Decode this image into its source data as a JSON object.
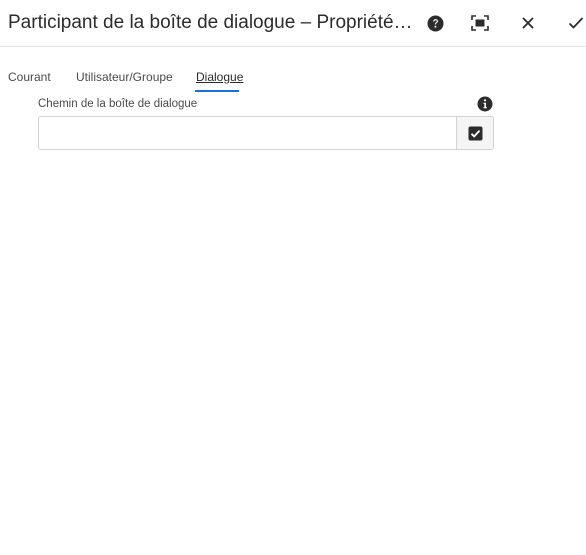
{
  "dialog": {
    "title": "Participant de la boîte de dialogue – Propriétés des éta..."
  },
  "header_actions": {
    "help_icon": "question-circle-icon",
    "fullscreen_icon": "fullscreen-icon",
    "close_icon": "close-icon",
    "done_icon": "checkmark-icon"
  },
  "tabs": [
    {
      "label": "Courant",
      "active": false
    },
    {
      "label": "Utilisateur/Groupe",
      "active": false
    },
    {
      "label": "Dialogue",
      "active": true
    }
  ],
  "form": {
    "dialog_path": {
      "label": "Chemin de la boîte de dialogue",
      "value": "",
      "placeholder": "",
      "info_icon": "info-circle-icon",
      "picker_icon": "checkbox-checked-icon"
    }
  },
  "colors": {
    "accent": "#1473e6",
    "text": "#2c2c2c",
    "border": "#d3d3d3"
  }
}
